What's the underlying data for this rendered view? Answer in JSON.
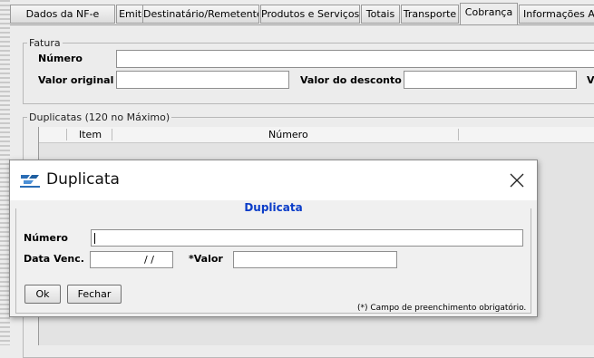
{
  "tabs": [
    {
      "label": "Dados da NF-e"
    },
    {
      "label": "Emitente"
    },
    {
      "label": "Destinatário/Remetente"
    },
    {
      "label": "Produtos e Serviços"
    },
    {
      "label": "Totais"
    },
    {
      "label": "Transporte"
    },
    {
      "label": "Cobrança"
    },
    {
      "label": "Informações Adi"
    }
  ],
  "active_tab": "Cobrança",
  "fatura": {
    "legend": "Fatura",
    "numero_label": "Número",
    "valor_original_label": "Valor original",
    "valor_desconto_label": "Valor do desconto",
    "trailing_label": "V",
    "numero_value": "",
    "valor_original_value": "",
    "valor_desconto_value": ""
  },
  "duplicatas": {
    "legend": "Duplicatas (120 no Máximo)",
    "columns": [
      "Item",
      "Número"
    ]
  },
  "dialog": {
    "title": "Duplicata",
    "group_title": "Duplicata",
    "numero_label": "Número",
    "numero_value": "",
    "data_venc_label": "Data Venc.",
    "data_venc_mask": "/ /",
    "valor_label": "*Valor",
    "valor_value": "",
    "ok_label": "Ok",
    "fechar_label": "Fechar",
    "required_note": "(*) Campo de preenchimento obrigatório.",
    "accent_color": "#0a3cc8"
  }
}
